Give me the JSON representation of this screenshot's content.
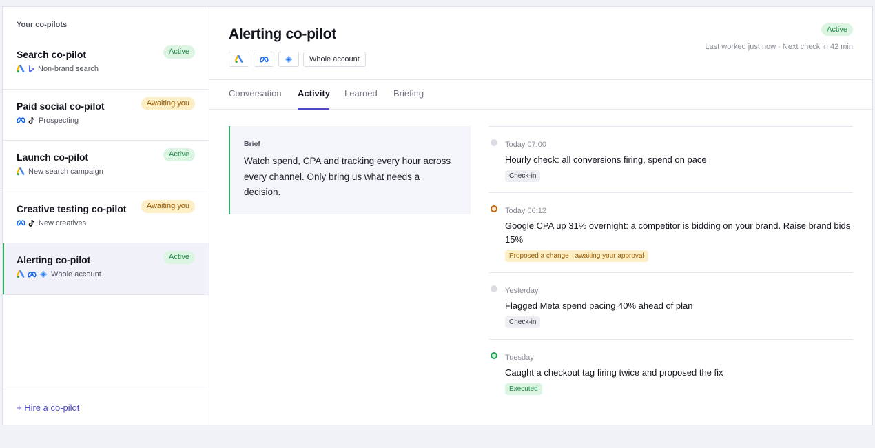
{
  "sidebar": {
    "heading": "Your co-pilots",
    "items": [
      {
        "name": "Search co-pilot",
        "status": "Active",
        "sub": "Non-brand search"
      },
      {
        "name": "Paid social co-pilot",
        "status": "Awaiting you",
        "sub": "Prospecting"
      },
      {
        "name": "Launch co-pilot",
        "status": "Active",
        "sub": "New search campaign"
      },
      {
        "name": "Creative testing co-pilot",
        "status": "Awaiting you",
        "sub": "New creatives"
      },
      {
        "name": "Alerting co-pilot",
        "status": "Active",
        "sub": "Whole account"
      }
    ],
    "hire": "+ Hire a co-pilot"
  },
  "header": {
    "title": "Alerting co-pilot",
    "scope_chip": "Whole account",
    "status": "Active",
    "last_worked": "Last worked just now · Next check in 42 min"
  },
  "tabs": [
    "Conversation",
    "Activity",
    "Learned",
    "Briefing"
  ],
  "brief": {
    "label": "Brief",
    "text": "Watch spend, CPA and tracking every hour across every channel. Only bring us what needs a decision."
  },
  "activity": [
    {
      "time": "Today 07:00",
      "text": "Hourly check: all conversions firing, spend on pace",
      "tag": "Check-in"
    },
    {
      "time": "Today 06:12",
      "text": "Google CPA up 31% overnight: a competitor is bidding on your brand. Raise brand bids 15%",
      "tag": "Proposed a change · awaiting your approval"
    },
    {
      "time": "Yesterday",
      "text": "Flagged Meta spend pacing 40% ahead of plan",
      "tag": "Check-in"
    },
    {
      "time": "Tuesday",
      "text": "Caught a checkout tag firing twice and proposed the fix",
      "tag": "Executed"
    }
  ],
  "icons": {
    "google_ads": "google-ads-icon",
    "bing": "bing-icon",
    "meta": "meta-icon",
    "tiktok": "tiktok-icon",
    "tag_manager": "tag-manager-icon"
  },
  "colors": {
    "accent": "#4b47c9",
    "active_green": "#2fae5e",
    "awaiting": "#9c5a00"
  }
}
